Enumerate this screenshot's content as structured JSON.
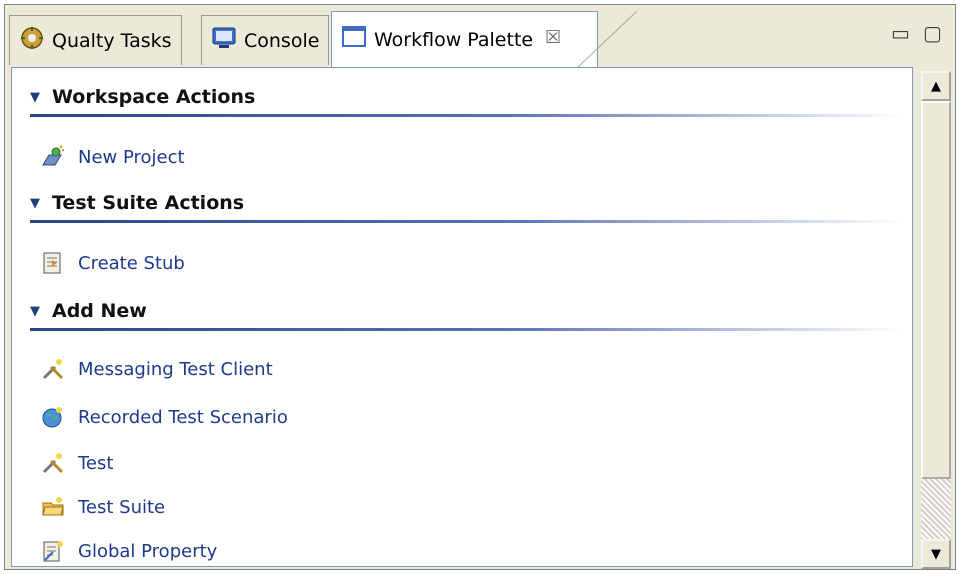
{
  "tabs": [
    {
      "label": "Qualty Tasks",
      "icon": "quality-tasks-icon"
    },
    {
      "label": "Console",
      "icon": "console-icon"
    },
    {
      "label": "Workflow Palette",
      "icon": "palette-icon",
      "active": true
    }
  ],
  "window_controls": {
    "close": "☒",
    "minimize": "▭",
    "maximize": "▢"
  },
  "sections": [
    {
      "title": "Workspace Actions",
      "items": [
        {
          "label": "New Project",
          "icon": "new-project-icon"
        }
      ]
    },
    {
      "title": "Test Suite Actions",
      "items": [
        {
          "label": "Create Stub",
          "icon": "create-stub-icon"
        }
      ]
    },
    {
      "title": "Add New",
      "items": [
        {
          "label": "Messaging Test Client",
          "icon": "tools-icon"
        },
        {
          "label": "Recorded Test Scenario",
          "icon": "globe-icon"
        },
        {
          "label": "Test",
          "icon": "tools-icon"
        },
        {
          "label": "Test Suite",
          "icon": "folder-icon"
        },
        {
          "label": "Global Property",
          "icon": "property-icon"
        }
      ]
    }
  ],
  "colors": {
    "accent": "#1e3a8c",
    "rule": "#2a4488",
    "tab_bg": "#ece9d8"
  }
}
